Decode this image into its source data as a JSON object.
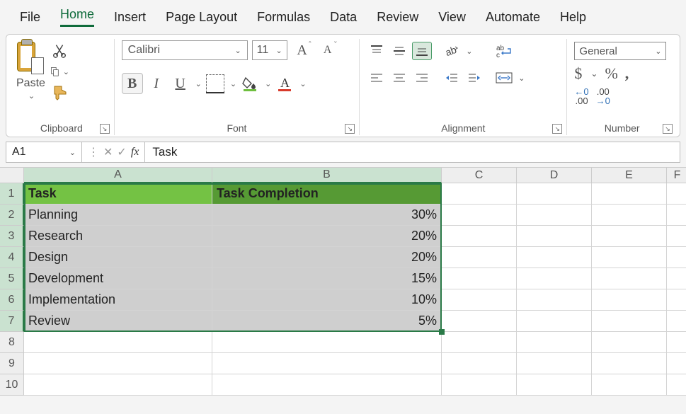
{
  "menu": [
    "File",
    "Home",
    "Insert",
    "Page Layout",
    "Formulas",
    "Data",
    "Review",
    "View",
    "Automate",
    "Help"
  ],
  "active_menu": "Home",
  "clipboard": {
    "paste_label": "Paste",
    "group_label": "Clipboard"
  },
  "font": {
    "name": "Calibri",
    "size": "11",
    "group_label": "Font"
  },
  "alignment": {
    "group_label": "Alignment"
  },
  "number": {
    "format": "General",
    "group_label": "Number"
  },
  "name_box": "A1",
  "formula": "Task",
  "columns": [
    "A",
    "B",
    "C",
    "D",
    "E",
    "F"
  ],
  "rows": [
    1,
    2,
    3,
    4,
    5,
    6,
    7,
    8,
    9,
    10
  ],
  "table": {
    "headers": [
      "Task",
      "Task Completion"
    ],
    "data": [
      [
        "Planning",
        "30%"
      ],
      [
        "Research",
        "20%"
      ],
      [
        "Design",
        "20%"
      ],
      [
        "Development",
        "15%"
      ],
      [
        "Implementation",
        "10%"
      ],
      [
        "Review",
        "5%"
      ]
    ]
  },
  "chart_data": {
    "type": "table",
    "columns": [
      "Task",
      "Task Completion"
    ],
    "rows": [
      {
        "Task": "Planning",
        "Task Completion": 0.3
      },
      {
        "Task": "Research",
        "Task Completion": 0.2
      },
      {
        "Task": "Design",
        "Task Completion": 0.2
      },
      {
        "Task": "Development",
        "Task Completion": 0.15
      },
      {
        "Task": "Implementation",
        "Task Completion": 0.1
      },
      {
        "Task": "Review",
        "Task Completion": 0.05
      }
    ]
  },
  "selection": {
    "range": "A1:B7",
    "active": "A1"
  }
}
